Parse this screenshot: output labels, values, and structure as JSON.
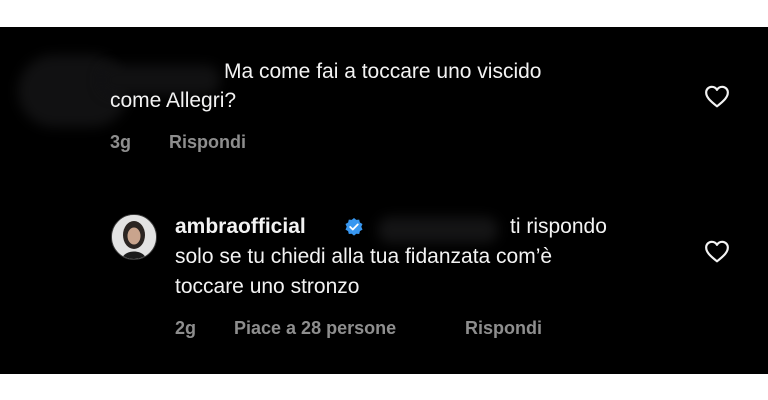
{
  "comment": {
    "text_line1": "Ma come fai a toccare uno viscido",
    "text_line2": "come Allegri?",
    "time": "3g",
    "reply_label": "Rispondi",
    "like_icon": "heart-outline-icon"
  },
  "reply": {
    "username": "ambraofficial",
    "verified_icon": "verified-badge-icon",
    "text_line1": "ti rispondo",
    "text_line2": "solo se tu chiedi alla tua fidanzata com’è",
    "text_line3": "toccare uno stronzo",
    "time": "2g",
    "likes_label": "Piace a 28 persone",
    "reply_label": "Rispondi",
    "like_icon": "heart-outline-icon"
  },
  "colors": {
    "background": "#000000",
    "text": "#f3f3f3",
    "meta": "#8e8e8e",
    "verified": "#3897f0"
  }
}
